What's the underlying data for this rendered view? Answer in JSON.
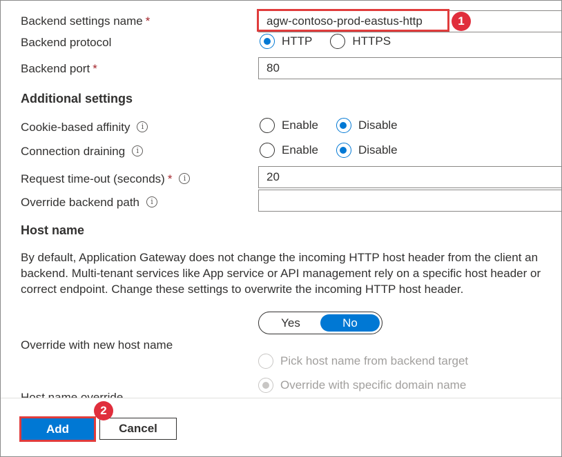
{
  "fields": {
    "backend_settings_name": {
      "label": "Backend settings name",
      "required": "*",
      "value": "agw-contoso-prod-eastus-http"
    },
    "backend_protocol": {
      "label": "Backend protocol",
      "options": [
        "HTTP",
        "HTTPS"
      ],
      "selected": "HTTP"
    },
    "backend_port": {
      "label": "Backend port",
      "required": "*",
      "value": "80"
    }
  },
  "additional_settings": {
    "heading": "Additional settings",
    "cookie_affinity": {
      "label": "Cookie-based affinity",
      "info": "i",
      "options": [
        "Enable",
        "Disable"
      ],
      "selected": "Disable"
    },
    "connection_draining": {
      "label": "Connection draining",
      "info": "i",
      "options": [
        "Enable",
        "Disable"
      ],
      "selected": "Disable"
    },
    "request_timeout": {
      "label": "Request time-out (seconds)",
      "required": "*",
      "info": "i",
      "value": "20"
    },
    "override_path": {
      "label": "Override backend path",
      "info": "i",
      "value": ""
    }
  },
  "host_name": {
    "heading": "Host name",
    "description_lines": [
      "By default, Application Gateway does not change the incoming HTTP host header from the client an",
      "backend. Multi-tenant services like App service or API management rely on a specific host header or",
      "correct endpoint. Change these settings to overwrite the incoming HTTP host header."
    ],
    "override_new_host": {
      "label": "Override with new host name",
      "options": [
        "Yes",
        "No"
      ],
      "selected": "No"
    },
    "host_options": [
      "Pick host name from backend target",
      "Override with specific domain name"
    ],
    "host_selected": "Override with specific domain name",
    "partial_label": "Host name override"
  },
  "footer": {
    "add_label": "Add",
    "cancel_label": "Cancel"
  },
  "annotations": [
    "1",
    "2"
  ],
  "colors": {
    "accent": "#0078d4",
    "highlight": "#e03c3c",
    "required": "#a4262c"
  }
}
